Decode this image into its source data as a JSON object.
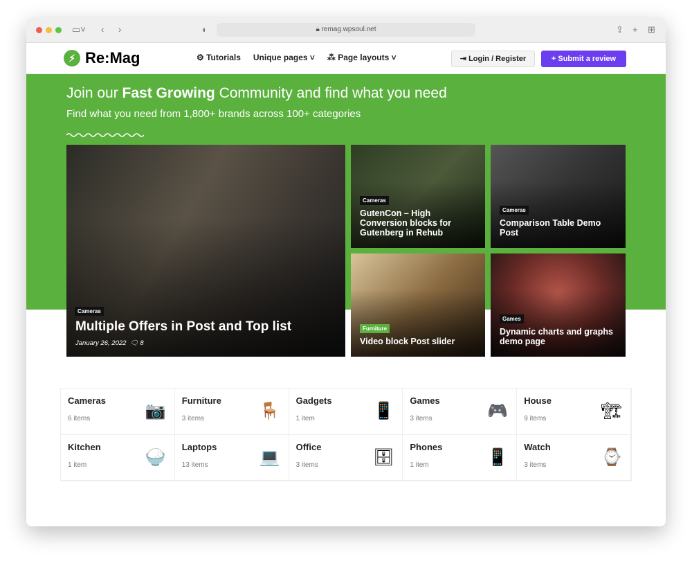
{
  "browser": {
    "url": "remag.wpsoul.net"
  },
  "nav": {
    "logo": "Re:Mag",
    "menu": [
      "Tutorials",
      "Unique pages",
      "Page layouts"
    ],
    "login": "Login / Register",
    "submit": "Submit a review"
  },
  "hero": {
    "title_pre": "Join our ",
    "title_bold": "Fast Growing",
    "title_post": " Community and find what you need",
    "subtitle": "Find what you need from 1,800+ brands across 100+ categories"
  },
  "posts": [
    {
      "tag": "Cameras",
      "title": "Multiple Offers in Post and Top list",
      "date": "January 26, 2022",
      "comments": "8"
    },
    {
      "tag": "Cameras",
      "title": "GutenCon – High Conversion blocks for Gutenberg in Rehub"
    },
    {
      "tag": "Cameras",
      "title": "Comparison Table Demo Post"
    },
    {
      "tag": "Furniture",
      "title": "Video block Post slider"
    },
    {
      "tag": "Games",
      "title": "Dynamic charts and graphs demo page"
    }
  ],
  "categories": [
    {
      "name": "Cameras",
      "count": "6 items",
      "icon": "📷"
    },
    {
      "name": "Furniture",
      "count": "3 items",
      "icon": "🪑"
    },
    {
      "name": "Gadgets",
      "count": "1 item",
      "icon": "📱"
    },
    {
      "name": "Games",
      "count": "3 items",
      "icon": "🎮"
    },
    {
      "name": "House",
      "count": "9 items",
      "icon": "🏗"
    },
    {
      "name": "Kitchen",
      "count": "1 item",
      "icon": "🍚"
    },
    {
      "name": "Laptops",
      "count": "13 items",
      "icon": "💻"
    },
    {
      "name": "Office",
      "count": "3 items",
      "icon": "🗄"
    },
    {
      "name": "Phones",
      "count": "1 item",
      "icon": "📱"
    },
    {
      "name": "Watch",
      "count": "3 items",
      "icon": "⌚"
    }
  ],
  "colors": {
    "brand": "#5bb13e",
    "accent": "#6b3ff0"
  }
}
